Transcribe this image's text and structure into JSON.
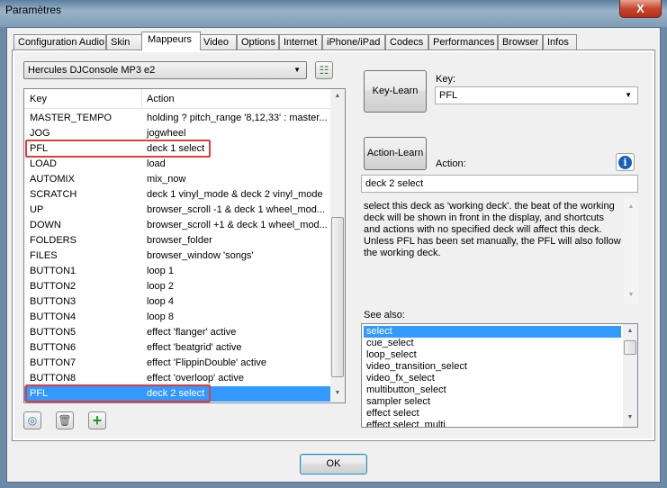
{
  "window": {
    "title": "Paramètres",
    "close_label": "X"
  },
  "tabs": [
    {
      "label": "Configuration Audio"
    },
    {
      "label": "Skin"
    },
    {
      "label": "Mappeurs",
      "active": true
    },
    {
      "label": "Video"
    },
    {
      "label": "Options"
    },
    {
      "label": "Internet"
    },
    {
      "label": "iPhone/iPad"
    },
    {
      "label": "Codecs"
    },
    {
      "label": "Performances"
    },
    {
      "label": "Browser"
    },
    {
      "label": "Infos"
    }
  ],
  "mapper": {
    "device": "Hercules DJConsole MP3 e2",
    "columns": {
      "key": "Key",
      "action": "Action"
    },
    "rows": [
      {
        "key": "MASTER_TEMPO",
        "action": "holding ? pitch_range '8,12,33' : master..."
      },
      {
        "key": "JOG",
        "action": "jogwheel"
      },
      {
        "key": "PFL",
        "action": "deck 1 select"
      },
      {
        "key": "LOAD",
        "action": "load"
      },
      {
        "key": "AUTOMIX",
        "action": "mix_now"
      },
      {
        "key": "SCRATCH",
        "action": "deck 1 vinyl_mode & deck 2 vinyl_mode"
      },
      {
        "key": "UP",
        "action": "browser_scroll -1 & deck 1 wheel_mod..."
      },
      {
        "key": "DOWN",
        "action": "browser_scroll +1 & deck 1 wheel_mod..."
      },
      {
        "key": "FOLDERS",
        "action": "browser_folder"
      },
      {
        "key": "FILES",
        "action": "browser_window 'songs'"
      },
      {
        "key": "BUTTON1",
        "action": "loop 1"
      },
      {
        "key": "BUTTON2",
        "action": "loop 2"
      },
      {
        "key": "BUTTON3",
        "action": "loop 4"
      },
      {
        "key": "BUTTON4",
        "action": "loop 8"
      },
      {
        "key": "BUTTON5",
        "action": "effect 'flanger' active"
      },
      {
        "key": "BUTTON6",
        "action": "effect 'beatgrid' active"
      },
      {
        "key": "BUTTON7",
        "action": "effect 'FlippinDouble' active"
      },
      {
        "key": "BUTTON8",
        "action": "effect 'overloop' active"
      },
      {
        "key": "PFL",
        "action": "deck 2 select",
        "selected": true
      }
    ]
  },
  "right": {
    "key_learn": "Key-Learn",
    "key_label": "Key:",
    "key_value": "PFL",
    "action_learn": "Action-Learn",
    "action_label": "Action:",
    "action_value": "deck 2 select",
    "description": "select this deck as 'working deck'. the beat of the working deck will be shown in front in the display, and shortcuts and actions with no specified deck will affect this deck.\nUnless PFL has been set manually, the PFL will also follow the working deck.",
    "see_also_label": "See also:",
    "see_also": [
      "select",
      "cue_select",
      "loop_select",
      "video_transition_select",
      "video_fx_select",
      "multibutton_select",
      "sampler select",
      "effect select",
      "effect select_multi"
    ]
  },
  "ok_label": "OK"
}
